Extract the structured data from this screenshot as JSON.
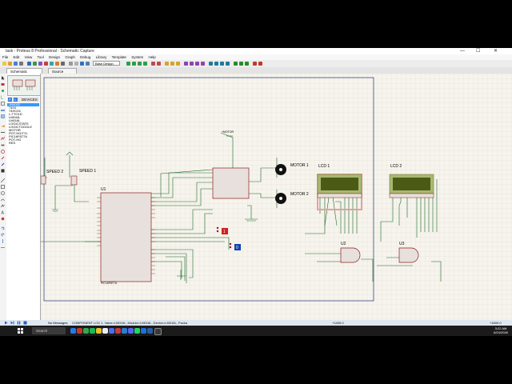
{
  "window": {
    "title": "task - Proteus 8 Professional - Schematic Capture",
    "controls": {
      "minimize": "—",
      "maximize": "☐",
      "close": "✕"
    }
  },
  "menu": [
    "File",
    "Edit",
    "View",
    "Tool",
    "Design",
    "Graph",
    "Debug",
    "Library",
    "Template",
    "System",
    "Help"
  ],
  "toolbar": {
    "variant_select": "Base Design"
  },
  "tabs": [
    {
      "label": "Schematic Capture"
    },
    {
      "label": "Source Code"
    }
  ],
  "devices": {
    "header_p": "P",
    "header_l": "L",
    "title": "DEVICES",
    "items": [
      "1N4002",
      "7404",
      "74HC04",
      "L-TTO1D",
      "LM044L",
      "LM016L",
      "LOGICSTATE",
      "LOGICTOGGLE",
      "MOTOR",
      "POT-HG/TYL",
      "PIC16F877A",
      "POT-HG",
      "RES"
    ],
    "selected_index": 0
  },
  "schematic": {
    "labels": {
      "speed1": "SPEED 1",
      "speed2": "SPEED 2",
      "motor1": "MOTOR 1",
      "motor2": "MOTOR 2",
      "lcd1": "LCD 1",
      "lcd2": "LCD 2",
      "u1": "U1",
      "u2": "U2",
      "u3": "U3",
      "mcu_part": "PIC16F877A",
      "driver_top": "+MOTOR",
      "logic1": "1",
      "logic0": "0"
    }
  },
  "status": {
    "messages": "No Messages",
    "component": "COMPONENT LCD 1, Value=LM016L, Module=LM016L, Device=LM016L, Packa",
    "coord_x": "+1400.0",
    "coord_y": "+1600.0"
  },
  "taskbar": {
    "search_placeholder": "Search",
    "time": "3:22 AM",
    "date": "6/24/2026"
  },
  "colors": {
    "canvas": "#f6f4ec",
    "wire": "#1a6b2a",
    "component_fill": "#e8e0dc",
    "component_border": "#8a1f1f",
    "lcd_screen": "#4b5a14",
    "lcd_frame": "#a8b870",
    "selection": "#e8a0a0",
    "sheet_border": "#3a4a8a",
    "selected_device": "#3399ff",
    "logic_high": "#d02020",
    "logic_low": "#1040b0"
  }
}
